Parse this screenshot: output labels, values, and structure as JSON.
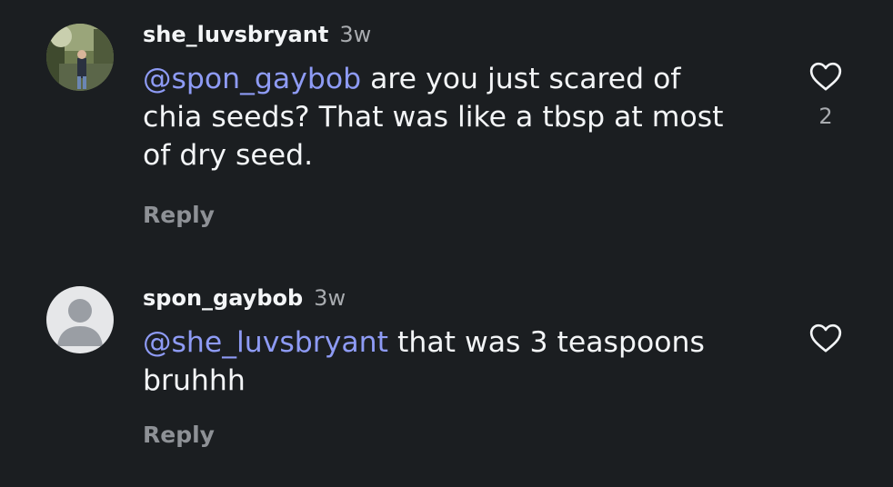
{
  "comments": [
    {
      "username": "she_luvsbryant",
      "time": "3w",
      "mention": "@spon_gaybob",
      "text": " are you just scared of chia seeds? That was like a tbsp at most of dry seed.",
      "reply_label": "Reply",
      "like_count": "2",
      "avatar": "profile-photo"
    },
    {
      "username": "spon_gaybob",
      "time": "3w",
      "mention": "@she_luvsbryant",
      "text": " that was 3 teaspoons bruhhh",
      "reply_label": "Reply",
      "like_count": "",
      "avatar": "default-avatar"
    }
  ],
  "colors": {
    "background": "#1b1e21",
    "text": "#f3f5f7",
    "mention": "#8e9bf5",
    "muted": "#8e9196"
  },
  "icons": [
    "heart-outline-icon",
    "default-avatar-icon"
  ]
}
